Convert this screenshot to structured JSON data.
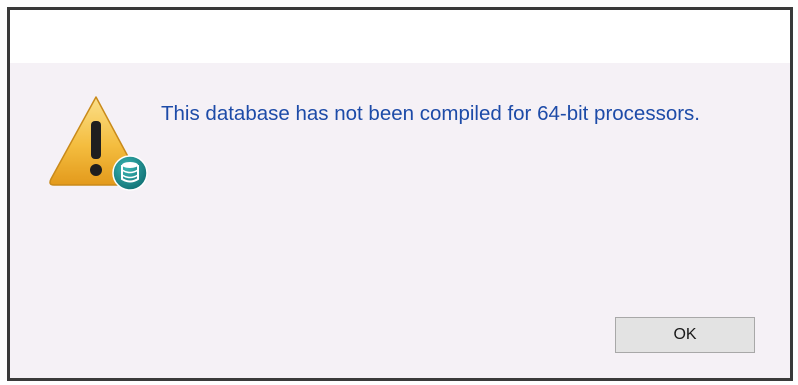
{
  "dialog": {
    "message": "This database has not been compiled for 64-bit processors.",
    "ok_label": "OK"
  },
  "icons": {
    "main": "warning-icon",
    "overlay": "database-icon"
  },
  "colors": {
    "message_text": "#1d4ba8",
    "dialog_background": "#f5f1f6",
    "warning_fill": "#f3b93a",
    "database_badge": "#1a8a8c"
  }
}
